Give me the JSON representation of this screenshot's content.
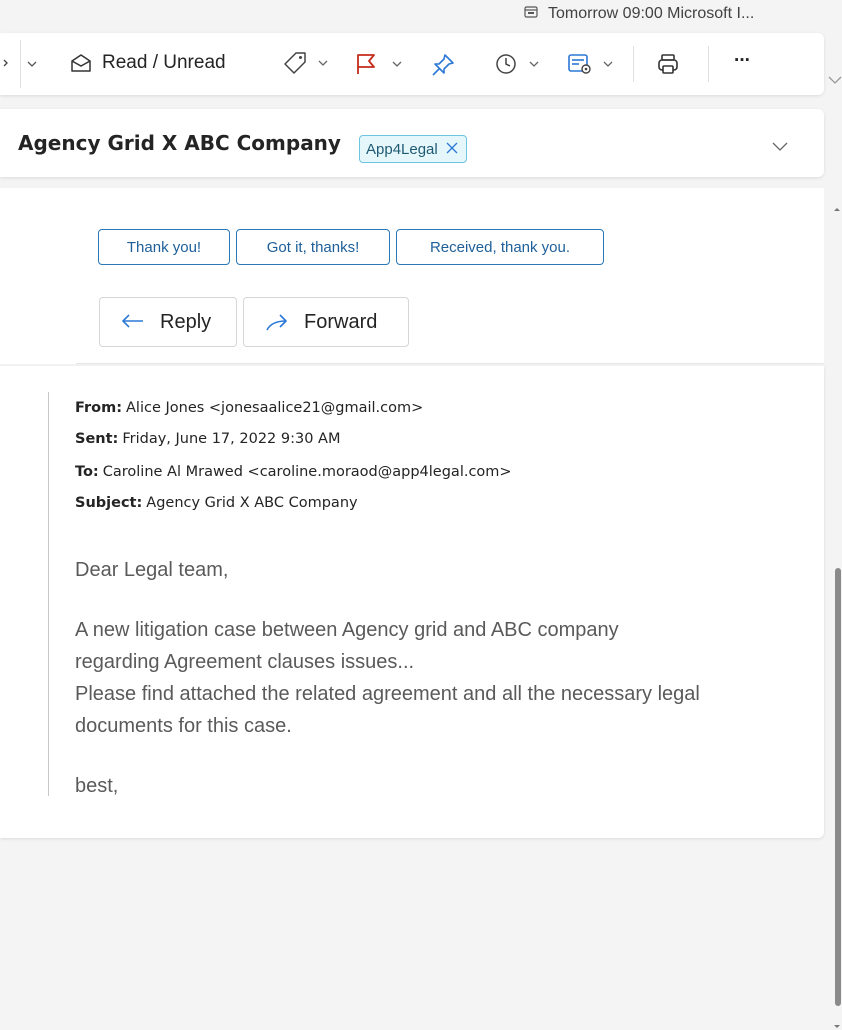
{
  "reminder": {
    "text": "Tomorrow 09:00 Microsoft I..."
  },
  "toolbar": {
    "read_unread_label": "Read / Unread",
    "more_label": "···",
    "flag_color": "#c42b1c",
    "pin_color": "#2b78d6",
    "accent": "#2b78d6"
  },
  "subject_bar": {
    "title": "Agency Grid X ABC Company",
    "category": "App4Legal"
  },
  "quick_replies": [
    "Thank you!",
    "Got it, thanks!",
    "Received, thank you."
  ],
  "actions": {
    "reply": "Reply",
    "forward": "Forward"
  },
  "email": {
    "from_label": "From:",
    "from_value": "Alice Jones <jonesaalice21@gmail.com>",
    "sent_label": "Sent:",
    "sent_value": "Friday, June 17, 2022 9:30 AM",
    "to_label": "To:",
    "to_value": "Caroline Al Mrawed <caroline.moraod@app4legal.com>",
    "subject_label": "Subject:",
    "subject_value": "Agency Grid X ABC Company",
    "greeting": "Dear Legal team,",
    "para1_line1": "A new litigation case between Agency grid and ABC company",
    "para1_line2": "regarding Agreement clauses issues...",
    "para1_line3": "Please find attached the related agreement and all the necessary legal",
    "para1_line4": "documents for this case.",
    "signoff": "best,"
  }
}
